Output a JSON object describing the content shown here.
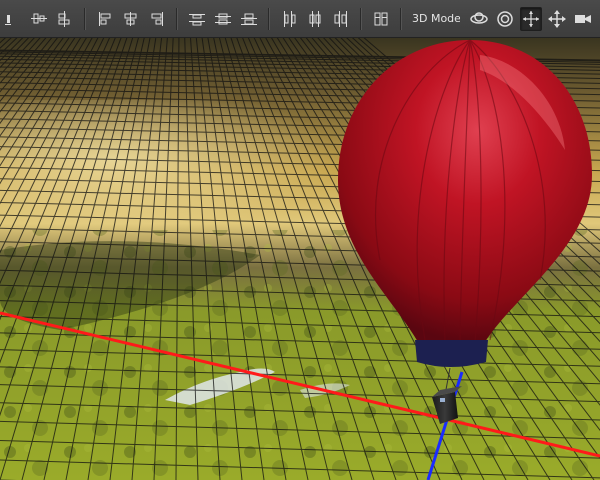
{
  "toolbar": {
    "mode_label": "3D Mode:",
    "align_buttons": [
      {
        "icon": "align-bottom-edges-icon"
      },
      {
        "icon": "align-top-edges-icon"
      },
      {
        "icon": "align-vertical-centers-icon"
      },
      {
        "icon": "align-left-edges-icon"
      },
      {
        "icon": "align-horizontal-centers-icon"
      },
      {
        "icon": "align-right-edges-icon"
      }
    ],
    "distribute_buttons": [
      {
        "icon": "distribute-top-icon"
      },
      {
        "icon": "distribute-vertical-centers-icon"
      },
      {
        "icon": "distribute-bottom-icon"
      },
      {
        "icon": "distribute-left-icon"
      },
      {
        "icon": "distribute-horizontal-centers-icon"
      },
      {
        "icon": "distribute-right-icon"
      }
    ],
    "auto_align_button": {
      "icon": "auto-align-layers-icon"
    },
    "mode_buttons": [
      {
        "icon": "orbit-3d-icon",
        "active": false
      },
      {
        "icon": "roll-3d-icon",
        "active": false
      },
      {
        "icon": "pan-3d-icon",
        "active": true
      },
      {
        "icon": "slide-3d-icon",
        "active": false
      },
      {
        "icon": "scale-3d-camera-icon",
        "active": false
      }
    ]
  },
  "scene": {
    "object": "hot-air-balloon",
    "balloon_color": "#b5121b",
    "x_axis_color": "#ff1a1a",
    "z_axis_color": "#1a2bff",
    "ground_color": "#8a9a2a",
    "sky_color": "#c2a24a"
  }
}
